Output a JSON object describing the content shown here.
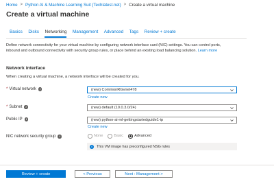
{
  "breadcrumb": {
    "items": [
      "Home",
      "Python AI & Machine Learning Suit (Techlatest.net)",
      "Create a virtual machine"
    ],
    "separator": ">"
  },
  "page": {
    "title": "Create a virtual machine"
  },
  "tabs": [
    {
      "label": "Basics",
      "active": false
    },
    {
      "label": "Disks",
      "active": false
    },
    {
      "label": "Networking",
      "active": true
    },
    {
      "label": "Management",
      "active": false
    },
    {
      "label": "Advanced",
      "active": false
    },
    {
      "label": "Tags",
      "active": false
    },
    {
      "label": "Review + create",
      "active": false
    }
  ],
  "description": {
    "text": "Define network connectivity for your virtual machine by configuring network interface card (NIC) settings. You can control ports, inbound and outbound connectivity with security group rules, or place behind an existing load balancing solution.",
    "learn_more": "Learn more"
  },
  "network_interface": {
    "heading": "Network interface",
    "subtext": "When creating a virtual machine, a network interface will be created for you."
  },
  "fields": {
    "virtual_network": {
      "label": "Virtual network",
      "value": "(new) CommonRGvnet478",
      "create_new": "Create new"
    },
    "subnet": {
      "label": "Subnet",
      "value": "(new) default (10.0.3.0/24)"
    },
    "public_ip": {
      "label": "Public IP",
      "value": "(new) python-ai-ml-gettingstartedguide1-ip",
      "create_new": "Create new"
    },
    "nsg": {
      "label": "NIC network security group",
      "options": [
        "None",
        "Basic",
        "Advanced"
      ],
      "selected": "Advanced",
      "info": "This VM image has preconfigured NSG rules"
    }
  },
  "footer": {
    "review_create": "Review + create",
    "previous": "< Previous",
    "next": "Next : Management >"
  },
  "colors": {
    "accent": "#0078d4",
    "required": "#a4262c",
    "info_bg": "#f3f2f1"
  }
}
